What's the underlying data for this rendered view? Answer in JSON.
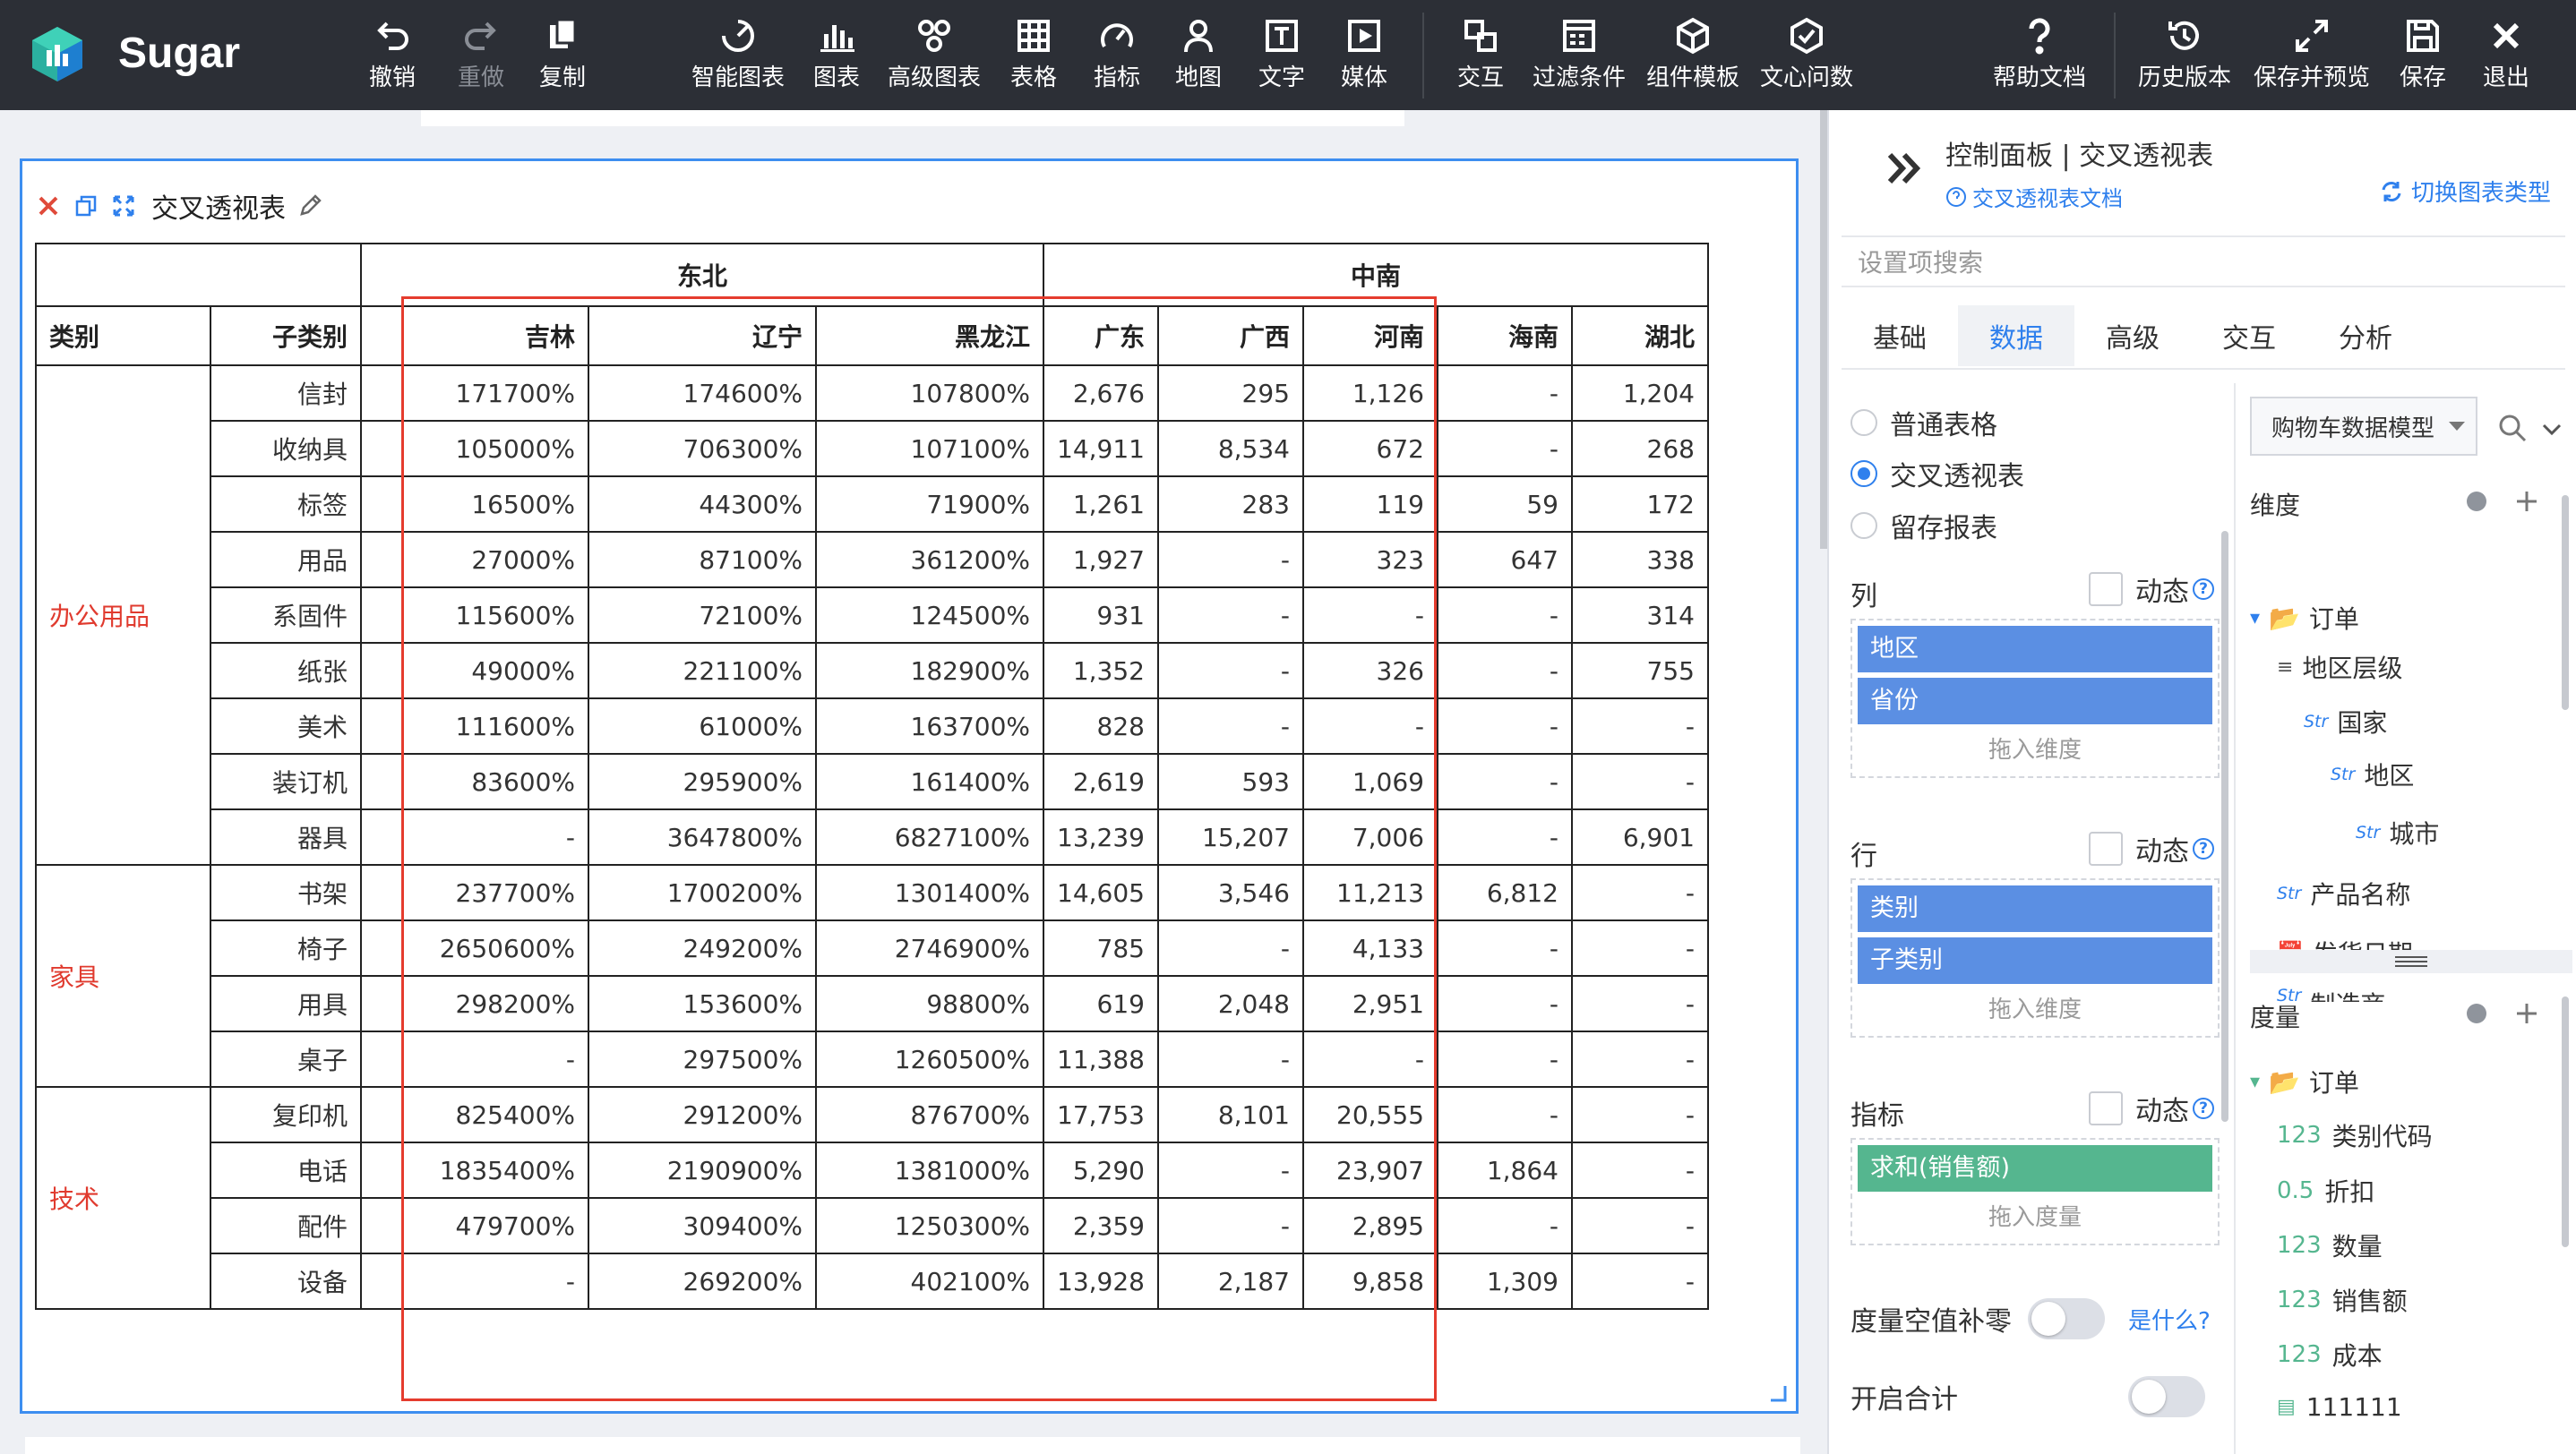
{
  "app": {
    "brand": "Sugar"
  },
  "toolbar": {
    "items": [
      {
        "key": "undo",
        "label": "撤销",
        "icon": "undo-icon"
      },
      {
        "key": "redo",
        "label": "重做",
        "icon": "redo-icon"
      },
      {
        "key": "copy",
        "label": "复制",
        "icon": "copy-icon"
      },
      {
        "key": "smart_chart",
        "label": "智能图表",
        "icon": "smart-chart-icon"
      },
      {
        "key": "chart",
        "label": "图表",
        "icon": "bar-chart-icon"
      },
      {
        "key": "advanced_chart",
        "label": "高级图表",
        "icon": "advanced-chart-icon"
      },
      {
        "key": "table",
        "label": "表格",
        "icon": "table-icon"
      },
      {
        "key": "indicator",
        "label": "指标",
        "icon": "gauge-icon"
      },
      {
        "key": "map",
        "label": "地图",
        "icon": "map-pin-icon"
      },
      {
        "key": "text",
        "label": "文字",
        "icon": "text-icon"
      },
      {
        "key": "media",
        "label": "媒体",
        "icon": "media-icon"
      },
      {
        "key": "interaction",
        "label": "交互",
        "icon": "interaction-icon"
      },
      {
        "key": "filter",
        "label": "过滤条件",
        "icon": "filter-icon"
      },
      {
        "key": "component_template",
        "label": "组件模板",
        "icon": "component-template-icon"
      },
      {
        "key": "wenxin",
        "label": "文心问数",
        "icon": "wenxin-icon"
      },
      {
        "key": "help",
        "label": "帮助文档",
        "icon": "help-icon"
      },
      {
        "key": "history",
        "label": "历史版本",
        "icon": "history-icon"
      },
      {
        "key": "save_preview",
        "label": "保存并预览",
        "icon": "expand-icon"
      },
      {
        "key": "save",
        "label": "保存",
        "icon": "save-icon"
      },
      {
        "key": "exit",
        "label": "退出",
        "icon": "close-icon"
      }
    ]
  },
  "widget": {
    "title": "交叉透视表"
  },
  "pivot": {
    "col_header_row1": {
      "regions": [
        "东北",
        "中南"
      ]
    },
    "col_header_row2": {
      "category": "类别",
      "subcategory": "子类别",
      "provinces": [
        "吉林",
        "辽宁",
        "黑龙江",
        "广东",
        "广西",
        "河南",
        "海南",
        "湖北"
      ]
    },
    "groups": [
      {
        "category": "办公用品",
        "rows": [
          {
            "sub": "信封",
            "cells": [
              "171700%",
              "174600%",
              "107800%",
              "2,676",
              "295",
              "1,126",
              "-",
              "1,204"
            ]
          },
          {
            "sub": "收纳具",
            "cells": [
              "105000%",
              "706300%",
              "107100%",
              "14,911",
              "8,534",
              "672",
              "-",
              "268"
            ]
          },
          {
            "sub": "标签",
            "cells": [
              "16500%",
              "44300%",
              "71900%",
              "1,261",
              "283",
              "119",
              "59",
              "172"
            ]
          },
          {
            "sub": "用品",
            "cells": [
              "27000%",
              "87100%",
              "361200%",
              "1,927",
              "-",
              "323",
              "647",
              "338"
            ]
          },
          {
            "sub": "系固件",
            "cells": [
              "115600%",
              "72100%",
              "124500%",
              "931",
              "-",
              "-",
              "-",
              "314"
            ]
          },
          {
            "sub": "纸张",
            "cells": [
              "49000%",
              "221100%",
              "182900%",
              "1,352",
              "-",
              "326",
              "-",
              "755"
            ]
          },
          {
            "sub": "美术",
            "cells": [
              "111600%",
              "61000%",
              "163700%",
              "828",
              "-",
              "-",
              "-",
              "-"
            ]
          },
          {
            "sub": "装订机",
            "cells": [
              "83600%",
              "295900%",
              "161400%",
              "2,619",
              "593",
              "1,069",
              "-",
              "-"
            ]
          },
          {
            "sub": "器具",
            "cells": [
              "-",
              "3647800%",
              "6827100%",
              "13,239",
              "15,207",
              "7,006",
              "-",
              "6,901"
            ]
          }
        ]
      },
      {
        "category": "家具",
        "rows": [
          {
            "sub": "书架",
            "cells": [
              "237700%",
              "1700200%",
              "1301400%",
              "14,605",
              "3,546",
              "11,213",
              "6,812",
              "-"
            ]
          },
          {
            "sub": "椅子",
            "cells": [
              "2650600%",
              "249200%",
              "2746900%",
              "785",
              "-",
              "4,133",
              "-",
              "-"
            ]
          },
          {
            "sub": "用具",
            "cells": [
              "298200%",
              "153600%",
              "98800%",
              "619",
              "2,048",
              "2,951",
              "-",
              "-"
            ]
          },
          {
            "sub": "桌子",
            "cells": [
              "-",
              "297500%",
              "1260500%",
              "11,388",
              "-",
              "-",
              "-",
              "-"
            ]
          }
        ]
      },
      {
        "category": "技术",
        "rows": [
          {
            "sub": "复印机",
            "cells": [
              "825400%",
              "291200%",
              "876700%",
              "17,753",
              "8,101",
              "20,555",
              "-",
              "-"
            ]
          },
          {
            "sub": "电话",
            "cells": [
              "1835400%",
              "2190900%",
              "1381000%",
              "5,290",
              "-",
              "23,907",
              "1,864",
              "-"
            ]
          },
          {
            "sub": "配件",
            "cells": [
              "479700%",
              "309400%",
              "1250300%",
              "2,359",
              "-",
              "2,895",
              "-",
              "-"
            ]
          },
          {
            "sub": "设备",
            "cells": [
              "-",
              "269200%",
              "402100%",
              "13,928",
              "2,187",
              "9,858",
              "1,309",
              "-"
            ]
          }
        ]
      }
    ]
  },
  "panel": {
    "title": "控制面板 | 交叉透视表",
    "doc_link": "交叉透视表文档",
    "switch_type": "切换图表类型",
    "search_placeholder": "设置项搜索",
    "tabs": [
      "基础",
      "数据",
      "高级",
      "交互",
      "分析"
    ],
    "active_tab": "数据",
    "table_types": [
      {
        "label": "普通表格",
        "selected": false
      },
      {
        "label": "交叉透视表",
        "selected": true
      },
      {
        "label": "留存报表",
        "selected": false
      }
    ],
    "column_label": "列",
    "row_label": "行",
    "metric_label": "指标",
    "dynamic_label": "动态",
    "columns": [
      "地区",
      "省份"
    ],
    "rows": [
      "类别",
      "子类别"
    ],
    "metrics": [
      "求和(销售额)"
    ],
    "drop_dimension_hint": "拖入维度",
    "drop_measure_hint": "拖入度量",
    "fill_zero_label": "度量空值补零",
    "fill_zero_help": "是什么?",
    "enable_total_label": "开启合计",
    "model_select": "购物车数据模型",
    "dimension_title": "维度",
    "dimension_tree": [
      {
        "label": "订单",
        "type": "folder"
      },
      {
        "label": "地区层级",
        "type": "hierarchy"
      },
      {
        "label": "国家",
        "type": "Str"
      },
      {
        "label": "地区",
        "type": "Str"
      },
      {
        "label": "城市",
        "type": "Str"
      },
      {
        "label": "产品名称",
        "type": "Str"
      },
      {
        "label": "发货日期",
        "type": "date"
      },
      {
        "label": "制造商",
        "type": "Str"
      }
    ],
    "measure_title": "度量",
    "measure_tree": [
      {
        "label": "订单",
        "type": "folder"
      },
      {
        "label": "类别代码",
        "type": "123"
      },
      {
        "label": "折扣",
        "type": "0.5"
      },
      {
        "label": "数量",
        "type": "123"
      },
      {
        "label": "销售额",
        "type": "123"
      },
      {
        "label": "成本",
        "type": "123"
      },
      {
        "label": "111111",
        "type": "calc"
      }
    ],
    "colors": {
      "accent": "#2f80ed",
      "dim_pill": "#5b8fe3",
      "measure_pill": "#55b68f",
      "highlight": "#e53c2e"
    }
  }
}
